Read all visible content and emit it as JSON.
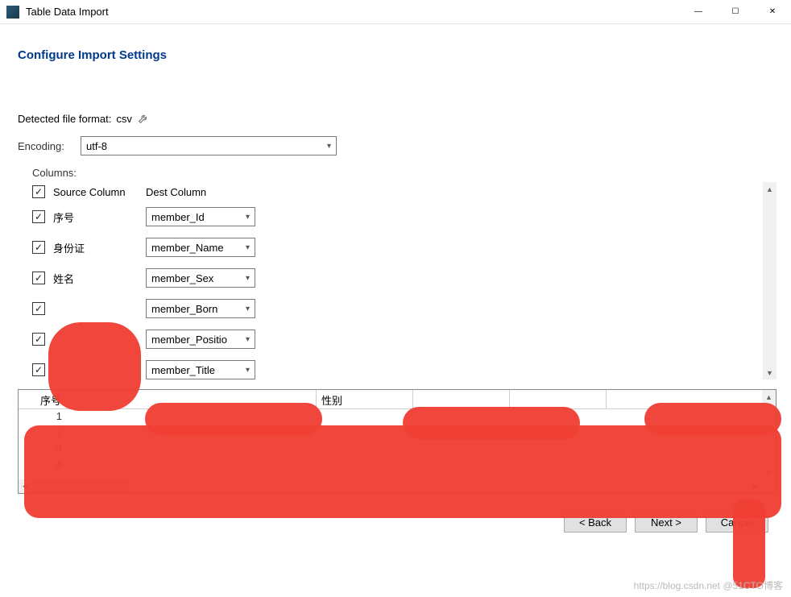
{
  "window": {
    "title": "Table Data Import",
    "minimize": "—",
    "maximize": "☐",
    "close": "✕"
  },
  "heading": "Configure Import Settings",
  "detected": {
    "label": "Detected file format:",
    "value": "csv"
  },
  "encoding": {
    "label": "Encoding:",
    "value": "utf-8"
  },
  "columns": {
    "label": "Columns:",
    "header_src": "Source Column",
    "header_dest": "Dest Column",
    "rows": [
      {
        "checked": true,
        "source": "序号",
        "dest": "member_Id"
      },
      {
        "checked": true,
        "source": "身份证",
        "dest": "member_Name"
      },
      {
        "checked": true,
        "source": "姓名",
        "dest": "member_Sex"
      },
      {
        "checked": true,
        "source": "",
        "dest": "member_Born"
      },
      {
        "checked": true,
        "source": "",
        "dest": "member_Positio"
      },
      {
        "checked": true,
        "source": "",
        "dest": "member_Title"
      }
    ]
  },
  "preview": {
    "headers": [
      "序号",
      "",
      "性别",
      "",
      ""
    ],
    "rows": [
      [
        "1",
        "",
        "",
        "",
        ""
      ],
      [
        "2",
        "",
        "",
        "",
        ""
      ],
      [
        "3",
        "",
        "",
        "",
        ""
      ],
      [
        "4",
        "",
        "",
        "",
        ""
      ]
    ]
  },
  "buttons": {
    "back": "< Back",
    "next": "Next >",
    "cancel": "Cancel"
  },
  "watermark": "https://blog.csdn.net @51CTO博客"
}
